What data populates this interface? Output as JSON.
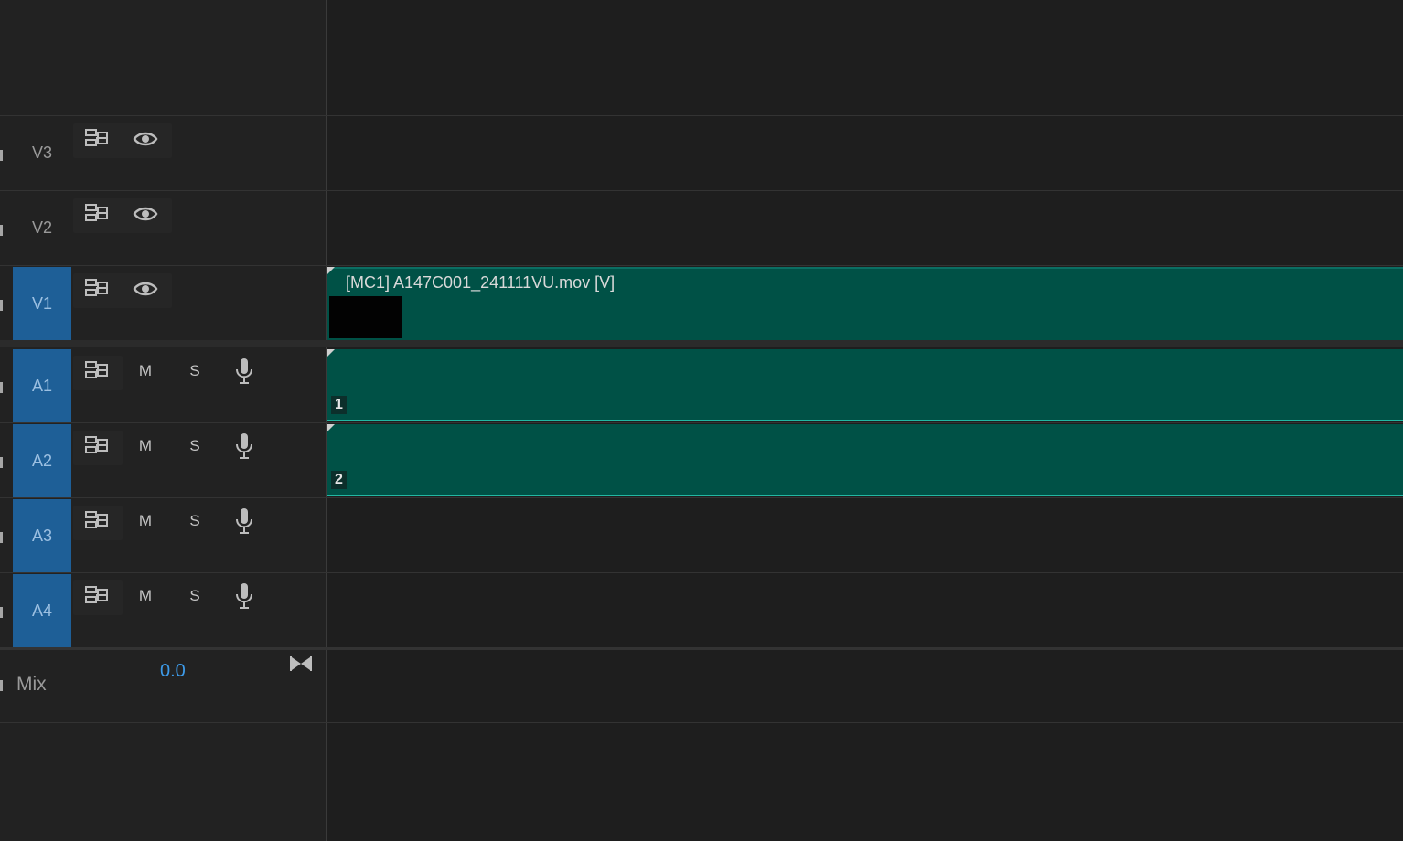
{
  "tracks": {
    "video": [
      {
        "label": "V3",
        "active": false
      },
      {
        "label": "V2",
        "active": false
      },
      {
        "label": "V1",
        "active": true
      }
    ],
    "audio": [
      {
        "label": "A1",
        "mute": "M",
        "solo": "S"
      },
      {
        "label": "A2",
        "mute": "M",
        "solo": "S"
      },
      {
        "label": "A3",
        "mute": "M",
        "solo": "S"
      },
      {
        "label": "A4",
        "mute": "M",
        "solo": "S"
      }
    ]
  },
  "mix": {
    "label": "Mix",
    "value": "0.0"
  },
  "clips": {
    "video_title": "[MC1] A147C001_241111VU.mov [V]",
    "audio_channel_1": "1",
    "audio_channel_2": "2"
  },
  "icons": [
    "sync-lock-icon",
    "eye-icon",
    "microphone-icon",
    "bowtie-icon"
  ],
  "colors": {
    "track_active_blue": "#1e5f97",
    "clip_teal": "#005146",
    "clip_edge": "#22b8a3",
    "mix_value_blue": "#3d9be9"
  }
}
